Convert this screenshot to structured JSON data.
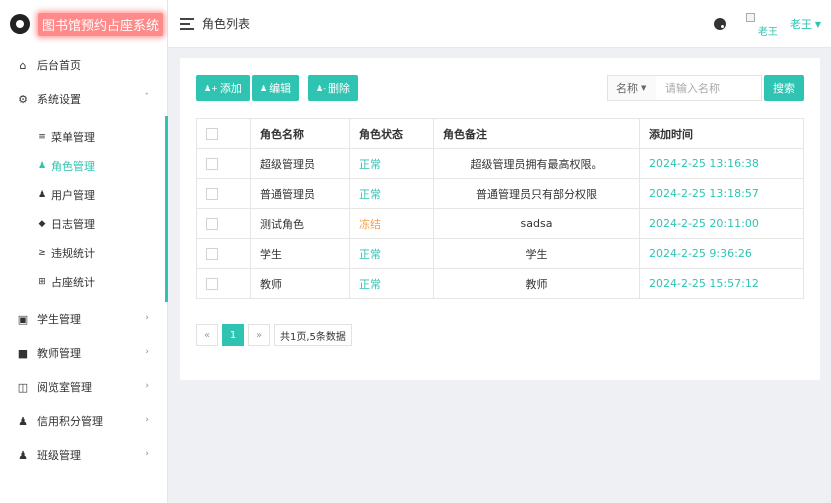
{
  "brand": {
    "title": "图书馆预约占座系统"
  },
  "header": {
    "page_title": "角色列表",
    "user_name": "老王",
    "avatar_alt": "老王"
  },
  "sidebar": {
    "items": [
      {
        "label": "后台首页",
        "icon": "home-icon"
      },
      {
        "label": "系统设置",
        "icon": "gear-icon",
        "expanded": true,
        "children": [
          {
            "label": "菜单管理",
            "icon": "list-icon"
          },
          {
            "label": "角色管理",
            "icon": "user-group-icon",
            "active": true
          },
          {
            "label": "用户管理",
            "icon": "users-icon"
          },
          {
            "label": "日志管理",
            "icon": "tag-icon"
          },
          {
            "label": "违规统计",
            "icon": "sort-icon"
          },
          {
            "label": "占座统计",
            "icon": "plus-square-icon"
          }
        ]
      },
      {
        "label": "学生管理",
        "icon": "id-card-icon"
      },
      {
        "label": "教师管理",
        "icon": "teacher-icon"
      },
      {
        "label": "阅览室管理",
        "icon": "book-icon"
      },
      {
        "label": "信用积分管理",
        "icon": "user-icon"
      },
      {
        "label": "班级管理",
        "icon": "group-icon"
      }
    ]
  },
  "toolbar": {
    "add_label": "添加",
    "edit_label": "编辑",
    "delete_label": "删除",
    "search_field": "名称",
    "search_placeholder": "请输入名称",
    "search_label": "搜索"
  },
  "table": {
    "headers": [
      "角色名称",
      "角色状态",
      "角色备注",
      "添加时间"
    ],
    "rows": [
      {
        "name": "超级管理员",
        "status": "正常",
        "note": "超级管理员拥有最高权限。",
        "time": "2024-2-25 13:16:38"
      },
      {
        "name": "普通管理员",
        "status": "正常",
        "note": "普通管理员只有部分权限",
        "time": "2024-2-25 13:18:57"
      },
      {
        "name": "测试角色",
        "status": "冻结",
        "note": "sadsa",
        "time": "2024-2-25 20:11:00"
      },
      {
        "name": "学生",
        "status": "正常",
        "note": "学生",
        "time": "2024-2-25 9:36:26"
      },
      {
        "name": "教师",
        "status": "正常",
        "note": "教师",
        "time": "2024-2-25 15:57:12"
      }
    ]
  },
  "pagination": {
    "prev": "«",
    "current": "1",
    "next": "»",
    "info": "共1页,5条数据"
  },
  "colors": {
    "accent": "#2fc4b2",
    "frozen": "#f4a04a",
    "brand_bg": "#ff8a8a"
  }
}
